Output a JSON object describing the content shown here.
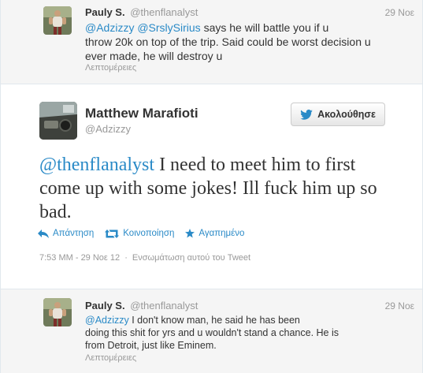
{
  "tweets": {
    "top_reply": {
      "fullname": "Pauly S.",
      "username": "@thenflanalyst",
      "time": "29 Νοε",
      "mention1": "@Adzizzy",
      "mention2": "@SrslySirius",
      "text_line1_rest": " says he will battle you if u",
      "text_line2": "throw 20k on top of the trip. Said could be worst decision u",
      "text_line3": "ever made, he will destroy u",
      "details": "Λεπτομέρειες"
    },
    "main": {
      "fullname": "Matthew Marafioti",
      "username": "@Adzizzy",
      "follow_label": "Ακολούθησε",
      "mention": "@thenflanalyst",
      "text_rest": " I need to meet him to first come up with some jokes! Ill fuck him up so bad.",
      "reply_label": "Απάντηση",
      "retweet_label": "Κοινοποίηση",
      "favorite_label": "Αγαπημένο",
      "timestamp": "7:53 ΜΜ - 29 Νοε 12",
      "separator": "·",
      "embed_label": "Ενσωμάτωση αυτού του Tweet"
    },
    "bottom_reply": {
      "fullname": "Pauly S.",
      "username": "@thenflanalyst",
      "time": "29 Νοε",
      "mention": "@Adzizzy",
      "text_line1_rest": " I don't know man, he said he has been",
      "text_line2": "doing this shit for yrs and u wouldn't stand a chance. He is",
      "text_line3": "from Detroit, just like Eminem.",
      "details": "Λεπτομέρειες"
    }
  },
  "colors": {
    "link": "#2a8ac7",
    "twitter_bird": "#2a8ac7",
    "muted": "#999999",
    "reply_bg": "#f5f5f5"
  },
  "icons": [
    "person-avatar",
    "car-interior-avatar",
    "twitter-bird-icon",
    "reply-arrow-icon",
    "retweet-icon",
    "star-icon"
  ]
}
